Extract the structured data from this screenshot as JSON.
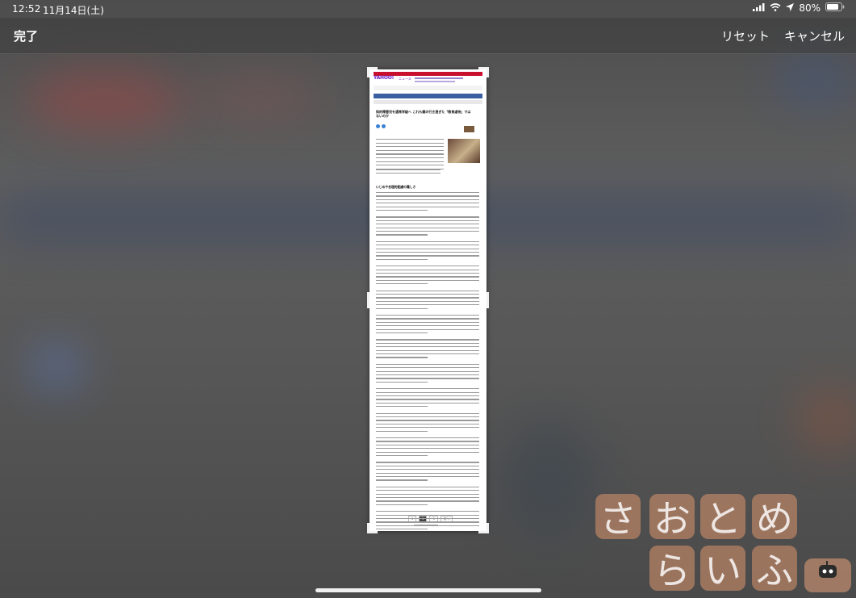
{
  "status_bar": {
    "time": "12:52",
    "date": "11月14日(土)",
    "battery": "80%",
    "icons": [
      "cellular-icon",
      "wifi-icon",
      "location-icon",
      "battery-icon"
    ]
  },
  "nav": {
    "done_label": "完了",
    "reset_label": "リセット",
    "cancel_label": "キャンセル"
  },
  "preview": {
    "brand": "YAHOO!",
    "brand_sub": "ニュース",
    "headline": "知的障害児を通常学級へ これも親の行き過ぎた「教育虐待」ではないのか",
    "section_heading": "いじめや合理的配慮の難しさ",
    "pagination": [
      "1",
      "2",
      "3",
      "次へ"
    ]
  },
  "watermark": {
    "row1": [
      "さ",
      "お",
      "と",
      "め"
    ],
    "row2": [
      "ら",
      "い",
      "ふ"
    ]
  }
}
